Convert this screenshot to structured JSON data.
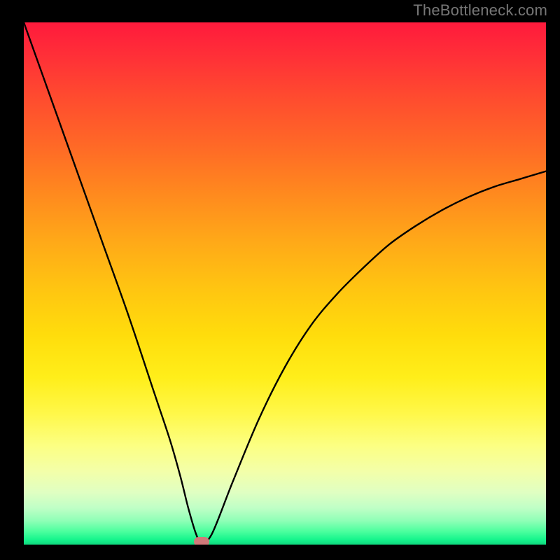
{
  "source_label": "TheBottleneck.com",
  "chart_data": {
    "type": "line",
    "title": "",
    "xlabel": "",
    "ylabel": "",
    "xlim": [
      0,
      100
    ],
    "ylim": [
      0,
      100
    ],
    "series": [
      {
        "name": "bottleneck-curve",
        "x": [
          0,
          5,
          10,
          15,
          20,
          25,
          28,
          30,
          31.5,
          33,
          34,
          36,
          40,
          45,
          50,
          55,
          60,
          65,
          70,
          75,
          80,
          85,
          90,
          95,
          100
        ],
        "values": [
          100,
          86,
          72,
          58,
          44,
          29,
          20,
          13,
          7,
          2,
          0.5,
          2,
          12,
          24,
          34,
          42,
          48,
          53,
          57.5,
          61,
          64,
          66.5,
          68.5,
          70,
          71.5
        ]
      }
    ],
    "annotations": [
      {
        "name": "optimal-marker",
        "x": 34,
        "y": 0.5,
        "color": "#d07a7a"
      }
    ],
    "background_gradient": {
      "top": "#ff1a3c",
      "mid": "#ffe400",
      "bottom": "#0fd87e"
    }
  }
}
